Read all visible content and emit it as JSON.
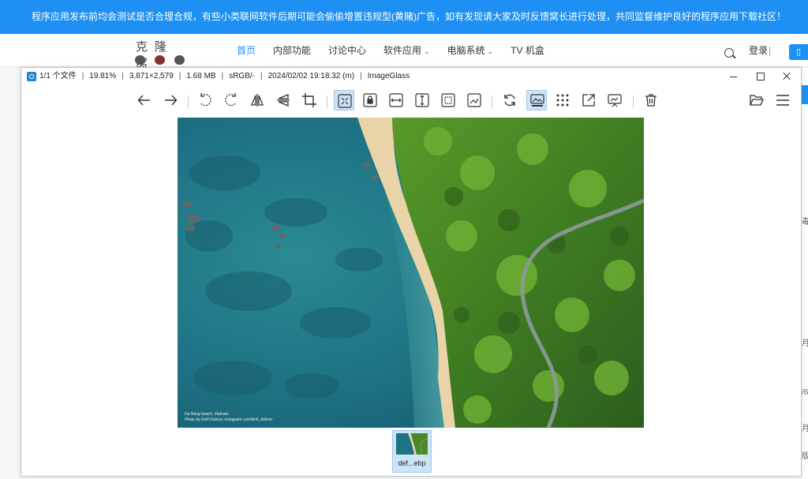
{
  "site": {
    "banner": "程序应用发布前均会测试是否合理合规，有些小类联网软件后期可能会偷偷增置违规型(黄赌)广告，如有发现请大家及时反馈窝长进行处理，共同监督维护良好的程序应用下载社区！",
    "logo_text": "克隆窝",
    "nav": [
      {
        "label": "首页",
        "has_caret": false
      },
      {
        "label": "内部功能",
        "has_caret": false
      },
      {
        "label": "讨论中心",
        "has_caret": false
      },
      {
        "label": "软件应用",
        "has_caret": true
      },
      {
        "label": "电脑系统",
        "has_caret": true
      },
      {
        "label": "TV 机盒",
        "has_caret": false
      }
    ],
    "login": "登录",
    "side_fragments": [
      "毒",
      "月",
      "/6",
      "月",
      "版"
    ],
    "accent": "#1e90f4"
  },
  "window": {
    "file_count": "1/1 个文件",
    "zoom": "19.81%",
    "dimensions": "3,871×2,579",
    "file_size": "1.68 MB",
    "color_space": "sRGB/-",
    "datetime": "2024/02/02 19:18:32 (m)",
    "app_name": "ImageGlass"
  },
  "toolbar": {
    "buttons": [
      {
        "name": "previous-image-button",
        "icon": "arrow-left-icon"
      },
      {
        "name": "next-image-button",
        "icon": "arrow-right-icon"
      },
      {
        "name": "rotate-left-button",
        "icon": "rotate-left-icon"
      },
      {
        "name": "rotate-right-button",
        "icon": "rotate-right-icon"
      },
      {
        "name": "flip-horizontal-button",
        "icon": "flip-horizontal-icon"
      },
      {
        "name": "flip-vertical-button",
        "icon": "flip-vertical-icon"
      },
      {
        "name": "crop-button",
        "icon": "crop-icon"
      },
      {
        "name": "auto-zoom-button",
        "icon": "auto-zoom-icon",
        "active": true
      },
      {
        "name": "lock-zoom-button",
        "icon": "lock-icon"
      },
      {
        "name": "scale-to-width-button",
        "icon": "scale-width-icon"
      },
      {
        "name": "scale-to-height-button",
        "icon": "scale-height-icon"
      },
      {
        "name": "scale-to-fit-button",
        "icon": "scale-fit-icon"
      },
      {
        "name": "scale-to-fill-button",
        "icon": "scale-fill-icon"
      },
      {
        "name": "refresh-button",
        "icon": "refresh-icon"
      },
      {
        "name": "gallery-button",
        "icon": "gallery-icon",
        "active": true
      },
      {
        "name": "checkerboard-button",
        "icon": "grid-dots-icon"
      },
      {
        "name": "fullscreen-button",
        "icon": "expand-icon"
      },
      {
        "name": "slideshow-button",
        "icon": "slideshow-icon"
      },
      {
        "name": "delete-button",
        "icon": "trash-icon"
      },
      {
        "name": "open-file-button",
        "icon": "folder-open-icon"
      },
      {
        "name": "main-menu-button",
        "icon": "hamburger-menu-icon"
      }
    ]
  },
  "viewer": {
    "credit_line1": "Da Nang beach, Vietnam",
    "credit_line2": "Photo by Kirill Dobrov, instagram.com/kirill_dobrov"
  },
  "thumbnails": [
    {
      "label": "def...ebp",
      "selected": true
    }
  ]
}
